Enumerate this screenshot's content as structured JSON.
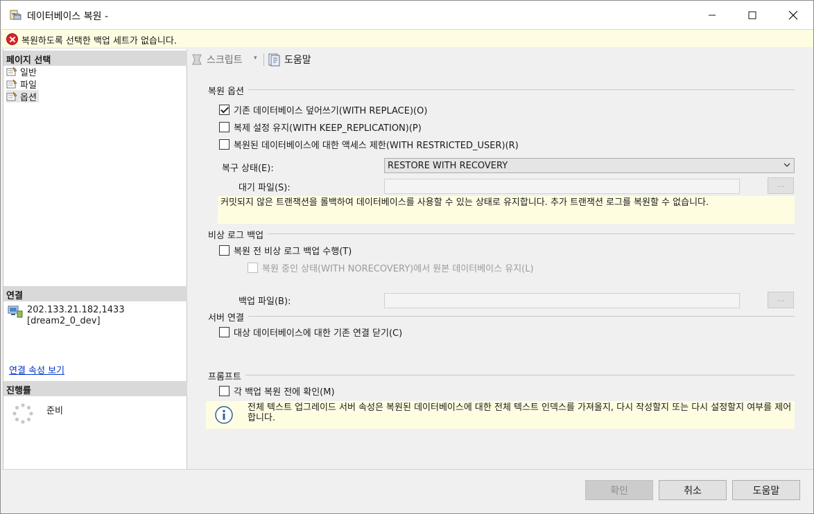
{
  "window": {
    "title": "데이터베이스 복원 -",
    "controls": {
      "minimize": "minimize",
      "maximize": "maximize",
      "close": "close"
    }
  },
  "error_banner": {
    "text": "복원하도록 선택한 백업 세트가 없습니다."
  },
  "left_panel": {
    "page_select_header": "페이지 선택",
    "pages": [
      {
        "label": "일반",
        "active": false
      },
      {
        "label": "파일",
        "active": false
      },
      {
        "label": "옵션",
        "active": true
      }
    ],
    "connection_header": "연결",
    "connection_server": "202.133.21.182,1433",
    "connection_db": "[dream2_0_dev]",
    "connection_link": "연결 속성 보기",
    "progress_header": "진행률",
    "progress_status": "준비"
  },
  "toolbar": {
    "script_label": "스크립트",
    "script_dropdown": "▾",
    "help_label": "도움말"
  },
  "restore_options": {
    "group_title": "복원 옵션",
    "replace": {
      "label": "기존 데이터베이스 덮어쓰기(WITH REPLACE)(O)",
      "checked": true
    },
    "keep_replication": {
      "label": "복제 설정 유지(WITH KEEP_REPLICATION)(P)",
      "checked": false
    },
    "restricted_user": {
      "label": "복원된 데이터베이스에 대한 액세스 제한(WITH RESTRICTED_USER)(R)",
      "checked": false
    },
    "recovery_state_label": "복구 상태(E):",
    "recovery_state_value": "RESTORE WITH RECOVERY",
    "standby_file_label": "대기 파일(S):",
    "standby_browse": "...",
    "recovery_info": "커밋되지 않은 트랜잭션을 롤백하여 데이터베이스를 사용할 수 있는 상태로 유지합니다. 추가 트랜잭션 로그를 복원할 수 없습니다."
  },
  "tail_log": {
    "group_title": "비상 로그 백업",
    "take_backup": {
      "label": "복원 전 비상 로그 백업 수행(T)",
      "checked": false
    },
    "leave_norecovery": {
      "label": "복원 중인 상태(WITH NORECOVERY)에서 원본 데이터베이스 유지(L)",
      "checked": false
    },
    "backup_file_label": "백업 파일(B):",
    "backup_browse": "..."
  },
  "server_connections": {
    "group_title": "서버 연결",
    "close_existing": {
      "label": "대상 데이터베이스에 대한 기존 연결 닫기(C)",
      "checked": false
    }
  },
  "prompt": {
    "group_title": "프롬프트",
    "confirm_each": {
      "label": "각 백업 복원 전에 확인(M)",
      "checked": false
    },
    "info_text": "전체 텍스트 업그레이드 서버 속성은 복원된 데이터베이스에 대한 전체 텍스트 인덱스를 가져올지, 다시 작성할지 또는 다시 설정할지 여부를 제어합니다."
  },
  "buttons": {
    "ok": "확인",
    "cancel": "취소",
    "help": "도움말"
  },
  "colors": {
    "banner_bg": "#fffde1",
    "error_red": "#d8232a",
    "link_blue": "#0033cc"
  }
}
